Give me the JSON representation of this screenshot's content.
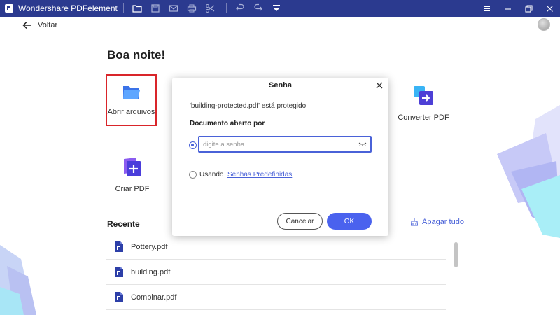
{
  "app": {
    "title": "Wondershare PDFelement"
  },
  "toolbar": {
    "icons": [
      "folder-icon",
      "save-icon",
      "mail-icon",
      "print-icon",
      "scissors-icon",
      "undo-icon",
      "redo-icon",
      "dropdown-menu-icon"
    ]
  },
  "window_controls": [
    "hamburger-menu-icon",
    "minimize-icon",
    "restore-icon",
    "close-icon"
  ],
  "nav": {
    "back_label": "Voltar"
  },
  "home": {
    "greeting": "Boa noite!",
    "tiles": {
      "open": "Abrir arquivos",
      "convert": "Converter PDF",
      "create": "Criar PDF"
    },
    "recent_title": "Recente",
    "clear_all": "Apagar tudo",
    "recent_files": [
      "Pottery.pdf",
      "building.pdf",
      "Combinar.pdf"
    ]
  },
  "dialog": {
    "title": "Senha",
    "message": "'building-protected.pdf' está protegido.",
    "label": "Documento aberto por",
    "password_value": "",
    "password_placeholder": "digite a senha",
    "using_label": "Usando",
    "preset_link": "Senhas Predefinidas",
    "cancel_label": "Cancelar",
    "ok_label": "OK"
  },
  "colors": {
    "titlebar": "#2b3a8f",
    "accent": "#4a62d8",
    "ok_button": "#4a62ee",
    "highlight_border": "#d9252a"
  }
}
